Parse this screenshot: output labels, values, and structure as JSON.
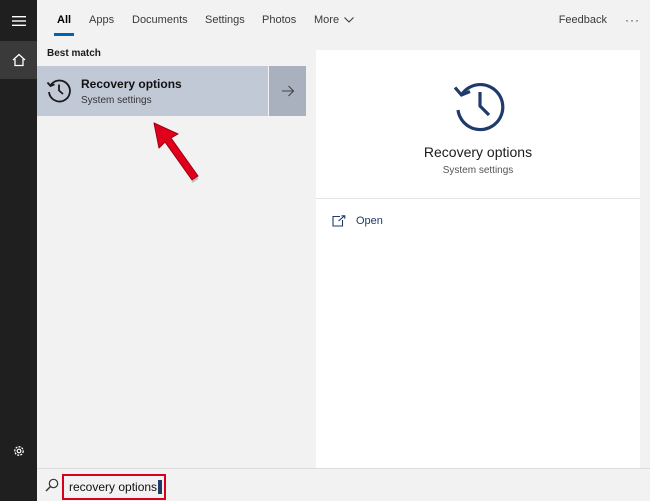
{
  "rail": {
    "menu_icon": "hamburger-icon",
    "home_icon": "home-icon",
    "settings_icon": "gear-icon"
  },
  "tabs": [
    {
      "label": "All",
      "active": true
    },
    {
      "label": "Apps",
      "active": false
    },
    {
      "label": "Documents",
      "active": false
    },
    {
      "label": "Settings",
      "active": false
    },
    {
      "label": "Photos",
      "active": false
    },
    {
      "label": "More",
      "active": false
    }
  ],
  "header": {
    "feedback_label": "Feedback",
    "more_options": "···"
  },
  "results": {
    "section_heading": "Best match",
    "best_match": {
      "title": "Recovery options",
      "subtitle": "System settings",
      "icon": "history-clock-icon"
    }
  },
  "preview": {
    "title": "Recovery options",
    "subtitle": "System settings",
    "icon": "history-clock-icon",
    "actions": [
      {
        "label": "Open",
        "icon": "open-external-icon"
      }
    ]
  },
  "search": {
    "value": "recovery options"
  },
  "colors": {
    "accent": "#0063b1",
    "selected_bg": "#c2c9d6",
    "annotation": "#d9001b",
    "icon_navy": "#1f3a6b"
  }
}
